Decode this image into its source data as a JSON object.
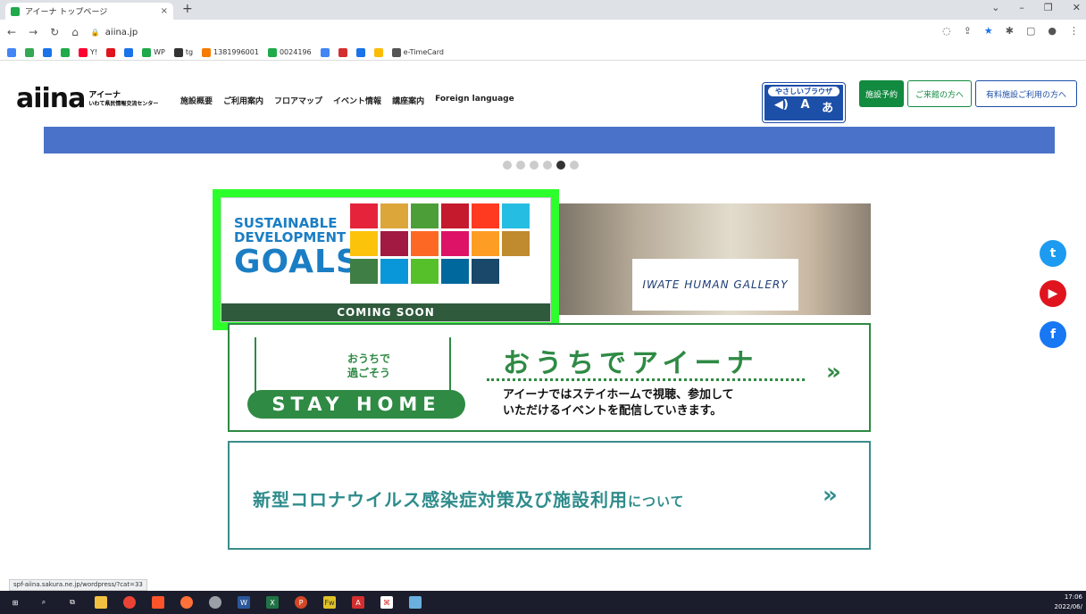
{
  "browser": {
    "tab_title": "アイーナ トップページ",
    "tab_close": "×",
    "new_tab": "+",
    "url": "aiina.jp",
    "bookmarks": [
      {
        "label": "",
        "color": "#4285f4"
      },
      {
        "label": "",
        "color": "#34a853"
      },
      {
        "label": "",
        "color": "#1a73e8"
      },
      {
        "label": "",
        "color": "#1faa4b"
      },
      {
        "label": "Y!",
        "color": "#ff0033"
      },
      {
        "label": "",
        "color": "#e0141e"
      },
      {
        "label": "",
        "color": "#1a73e8"
      },
      {
        "label": "WP",
        "color": "#1faa4b"
      },
      {
        "label": "tg",
        "color": "#333333"
      },
      {
        "label": "1381996001",
        "color": "#f57c00"
      },
      {
        "label": "0024196",
        "color": "#1faa4b"
      },
      {
        "label": "",
        "color": "#4285f4"
      },
      {
        "label": "",
        "color": "#d32f2f"
      },
      {
        "label": "",
        "color": "#1a73e8"
      },
      {
        "label": "",
        "color": "#fbbc05"
      },
      {
        "label": "e-TimeCard",
        "color": "#555555"
      }
    ],
    "status_url": "spf-aiina.sakura.ne.jp/wordpress/?cat=33"
  },
  "site": {
    "logo_word": "aiina",
    "logo_kana": "アイーナ",
    "logo_sub": "いわて県民情報交流センター",
    "nav": [
      "施設概要",
      "ご利用案内",
      "フロアマップ",
      "イベント情報",
      "講座案内",
      "Foreign language"
    ],
    "yasashii_label": "やさしいブラウザ",
    "yasashii_icons": [
      "◀)",
      "A",
      "あ"
    ],
    "btn_reserve": "施設予約",
    "btn_visit": "ご来館の方へ",
    "btn_paid": "有料施設ご利用の方へ"
  },
  "slider": {
    "count": 6,
    "active_index": 4
  },
  "sdg": {
    "line1": "SUSTAINABLE",
    "line2": "DEVELOPMENT",
    "line3": "GOALS",
    "banner": "COMING SOON",
    "colors": [
      "#e5243b",
      "#dda63a",
      "#4c9f38",
      "#c5192d",
      "#ff3a21",
      "#26bde2",
      "#fcc30b",
      "#a21942",
      "#fd6925",
      "#dd1367",
      "#fd9d24",
      "#bf8b2e",
      "#3f7e44",
      "#0a97d9",
      "#56c02b",
      "#00689d",
      "#19486a",
      "#ffffff"
    ]
  },
  "gallery": {
    "label": "IWATE HUMAN GALLERY"
  },
  "stayhome": {
    "house_line1": "おうちで",
    "house_line2": "過ごそう",
    "pill": "STAY HOME",
    "heading": "おうちでアイーナ",
    "desc1": "アイーナではステイホームで視聴、参加して",
    "desc2": "いただけるイベントを配信していきます。",
    "arrow": "»"
  },
  "corona": {
    "text": "新型コロナウイルス感染症対策及び施設利用",
    "text_small": "について",
    "arrow": "»"
  },
  "social": {
    "twitter": "t",
    "youtube": "▶",
    "facebook": "f"
  },
  "taskbar": {
    "time": "17:06",
    "date": "2022/06/"
  }
}
